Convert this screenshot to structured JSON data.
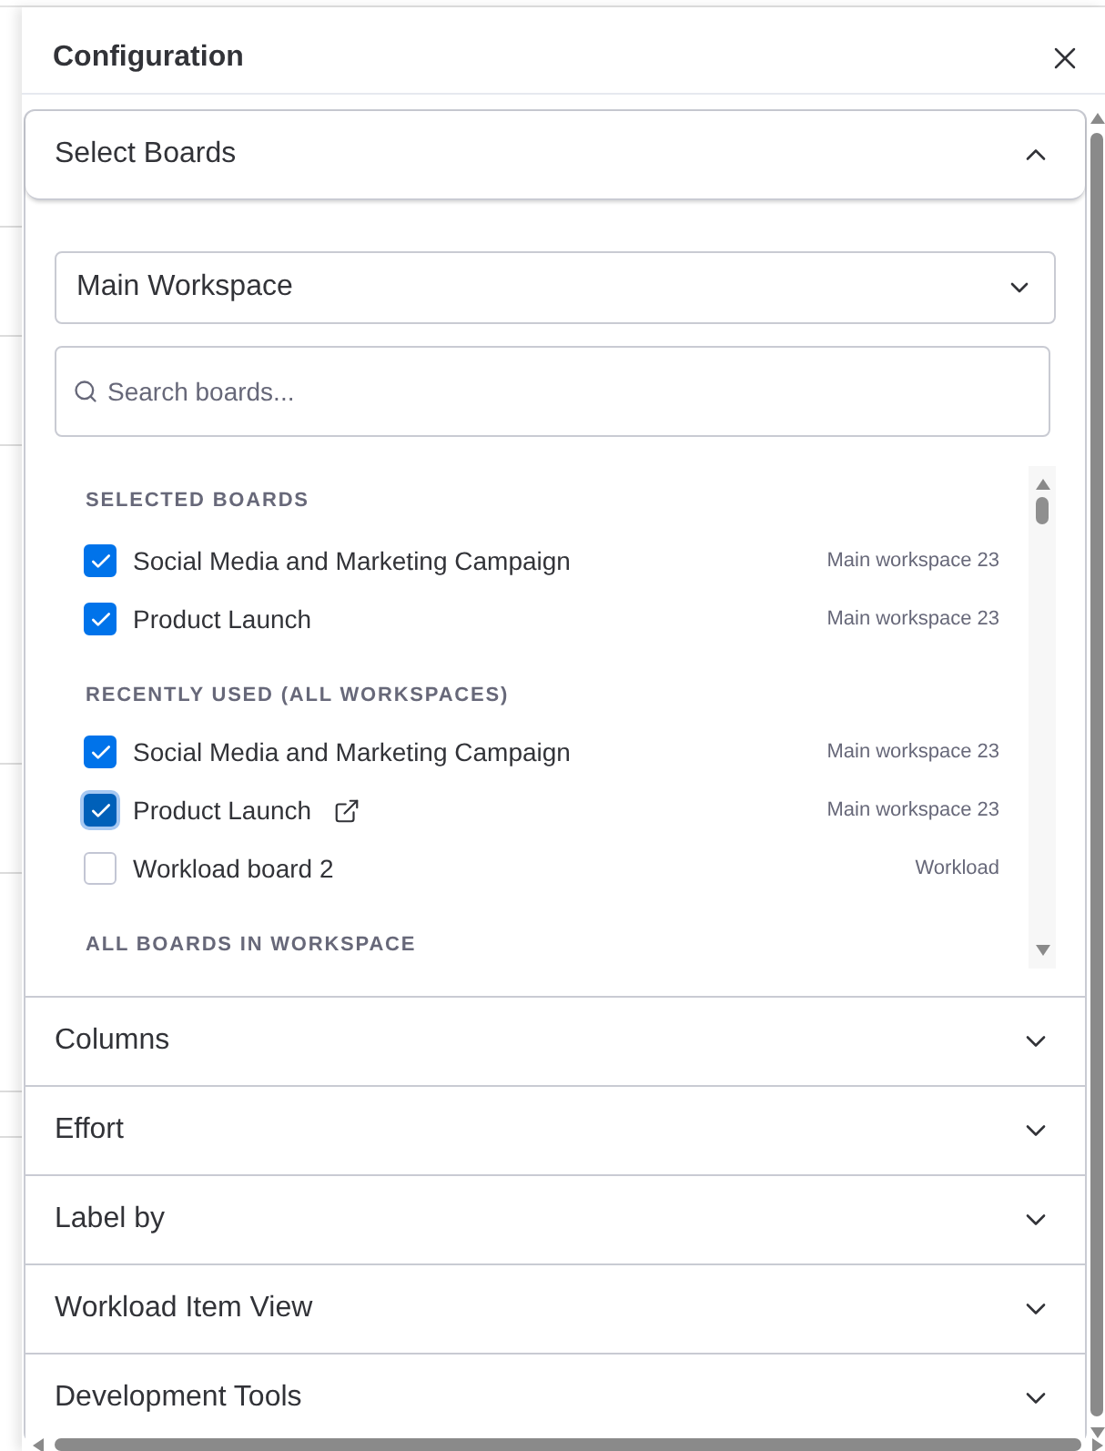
{
  "window": {
    "title": "Configuration"
  },
  "sections": [
    {
      "title": "Select Boards",
      "expanded": true,
      "workspace": {
        "value": "Main Workspace"
      },
      "search": {
        "placeholder": "Search boards..."
      },
      "groups": [
        {
          "heading": "SELECTED BOARDS",
          "boards": [
            {
              "name": "Social Media and Marketing Campaign",
              "workspace": "Main workspace 23",
              "checked": true,
              "focused": false,
              "external_link": false
            },
            {
              "name": "Product Launch",
              "workspace": "Main workspace 23",
              "checked": true,
              "focused": false,
              "external_link": false
            }
          ]
        },
        {
          "heading": "RECENTLY USED (ALL WORKSPACES)",
          "boards": [
            {
              "name": "Social Media and Marketing Campaign",
              "workspace": "Main workspace 23",
              "checked": true,
              "focused": false,
              "external_link": false
            },
            {
              "name": "Product Launch",
              "workspace": "Main workspace 23",
              "checked": true,
              "focused": true,
              "external_link": true
            },
            {
              "name": "Workload board 2",
              "workspace": "Workload",
              "checked": false,
              "focused": false,
              "external_link": false
            }
          ]
        },
        {
          "heading": "ALL BOARDS IN WORKSPACE"
        }
      ]
    },
    {
      "title": "Columns",
      "expanded": false
    },
    {
      "title": "Effort",
      "expanded": false
    },
    {
      "title": "Label by",
      "expanded": false
    },
    {
      "title": "Workload Item View",
      "expanded": false
    },
    {
      "title": "Development Tools",
      "expanded": false
    }
  ]
}
